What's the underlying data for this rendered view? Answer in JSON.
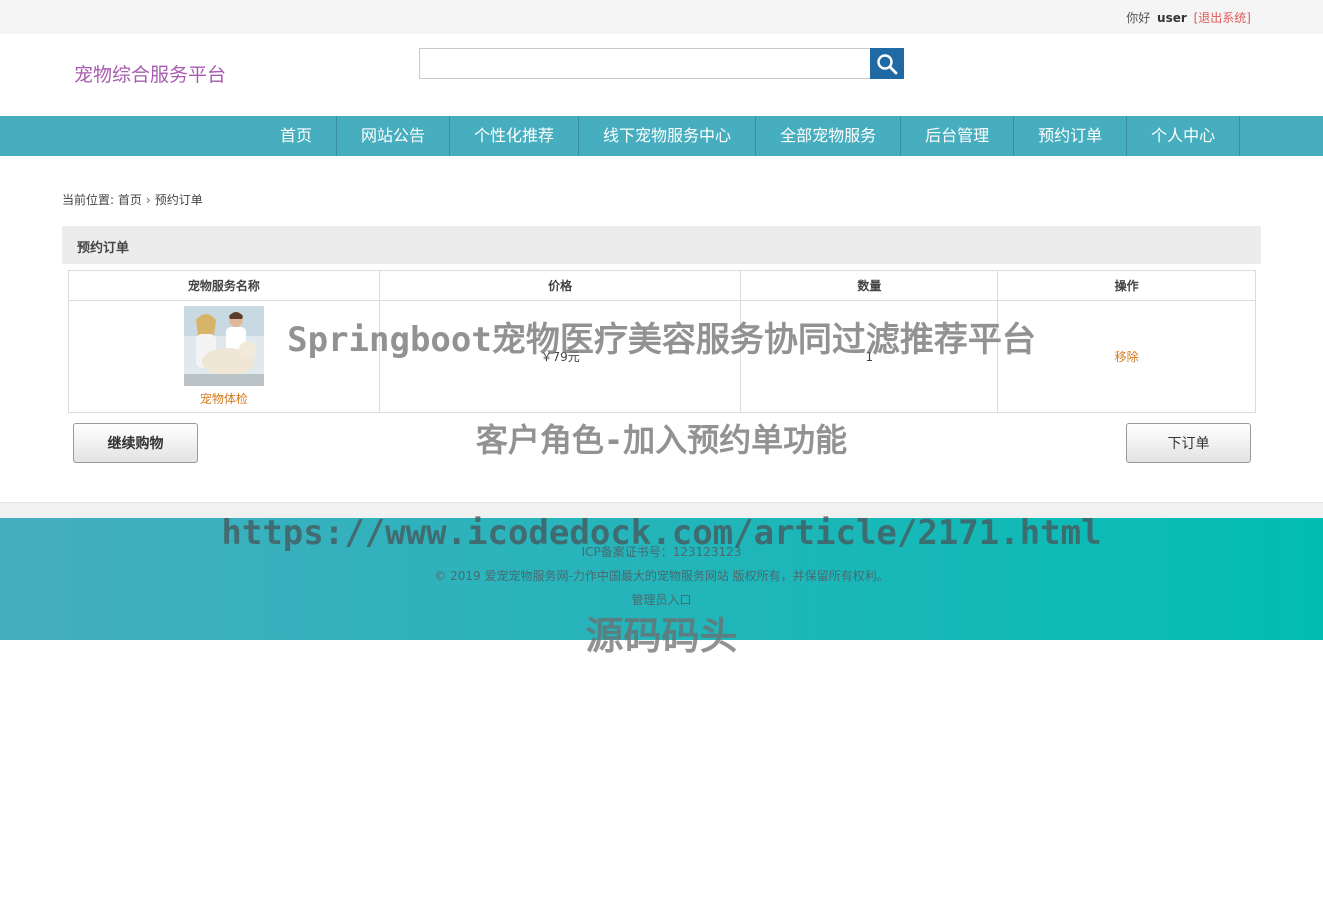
{
  "topbar": {
    "greeting": "你好",
    "username": "user",
    "logout": "[退出系统]"
  },
  "logo": "宠物综合服务平台",
  "search": {
    "placeholder": "",
    "icon": "search-icon"
  },
  "nav": [
    "首页",
    "网站公告",
    "个性化推荐",
    "线下宠物服务中心",
    "全部宠物服务",
    "后台管理",
    "预约订单",
    "个人中心"
  ],
  "breadcrumb": {
    "prefix": "当前位置:",
    "home": "首页",
    "sep": "›",
    "current": "预约订单"
  },
  "panel_title": "预约订单",
  "table": {
    "headers": [
      "宠物服务名称",
      "价格",
      "数量",
      "操作"
    ],
    "rows": [
      {
        "name": "宠物体检",
        "price": "￥79元",
        "qty": "1",
        "action": "移除"
      }
    ]
  },
  "buttons": {
    "continue": "继续购物",
    "order": "下订单"
  },
  "footer": {
    "icp": "ICP备案证书号：123123123",
    "copyright": "© 2019 爱宠宠物服务网-力作中国最大的宠物服务网站 版权所有，并保留所有权利。",
    "admin": "管理员入口"
  },
  "watermarks": [
    "Springboot宠物医疗美容服务协同过滤推荐平台",
    "客户角色-加入预约单功能",
    "https://www.icodedock.com/article/2171.html",
    "源码码头"
  ],
  "colors": {
    "nav": "#46aebf",
    "logo": "#a85bb0",
    "accent": "#d27a1e",
    "search_btn": "#1f6aa5"
  }
}
